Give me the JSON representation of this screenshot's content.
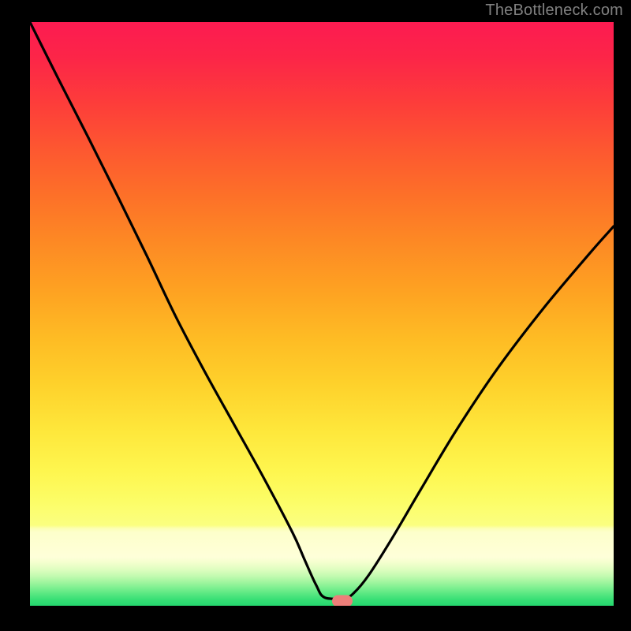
{
  "watermark": "TheBottleneck.com",
  "marker": {
    "x_pct": 53.5,
    "y_pct": 99.2
  },
  "gradient_stops": [
    {
      "offset": 0.0,
      "color": "#fc1b51"
    },
    {
      "offset": 0.06,
      "color": "#fc2548"
    },
    {
      "offset": 0.14,
      "color": "#fd3d3a"
    },
    {
      "offset": 0.22,
      "color": "#fd5830"
    },
    {
      "offset": 0.3,
      "color": "#fd7128"
    },
    {
      "offset": 0.38,
      "color": "#fd8a24"
    },
    {
      "offset": 0.46,
      "color": "#fea222"
    },
    {
      "offset": 0.54,
      "color": "#febb24"
    },
    {
      "offset": 0.62,
      "color": "#fed12b"
    },
    {
      "offset": 0.7,
      "color": "#fee73b"
    },
    {
      "offset": 0.77,
      "color": "#fef64f"
    },
    {
      "offset": 0.82,
      "color": "#fcfd66"
    },
    {
      "offset": 0.862,
      "color": "#fbff80"
    },
    {
      "offset": 0.868,
      "color": "#fcffb8"
    },
    {
      "offset": 0.874,
      "color": "#fdffcb"
    },
    {
      "offset": 0.917,
      "color": "#feffd9"
    },
    {
      "offset": 0.925,
      "color": "#f5ffcf"
    },
    {
      "offset": 0.937,
      "color": "#e0fec1"
    },
    {
      "offset": 0.949,
      "color": "#c3fab0"
    },
    {
      "offset": 0.96,
      "color": "#9ff59e"
    },
    {
      "offset": 0.97,
      "color": "#7bef8f"
    },
    {
      "offset": 0.98,
      "color": "#57e781"
    },
    {
      "offset": 0.99,
      "color": "#36df75"
    },
    {
      "offset": 1.0,
      "color": "#25d86f"
    }
  ],
  "chart_data": {
    "type": "line",
    "title": "",
    "xlabel": "",
    "ylabel": "",
    "xlim": [
      0,
      100
    ],
    "ylim": [
      0,
      100
    ],
    "x": [
      0,
      5,
      10,
      15,
      20,
      25,
      30,
      35,
      40,
      45,
      47,
      49,
      50.5,
      54,
      55.5,
      58,
      62,
      67,
      73,
      80,
      88,
      96,
      100
    ],
    "y": [
      100,
      90,
      80.2,
      70.2,
      60,
      49.5,
      40,
      31,
      22,
      12.5,
      8,
      3.6,
      1.4,
      1.4,
      2.2,
      5.2,
      11.5,
      20,
      30,
      40.5,
      51,
      60.5,
      65
    ],
    "optimum_marker_x": 53.5
  }
}
